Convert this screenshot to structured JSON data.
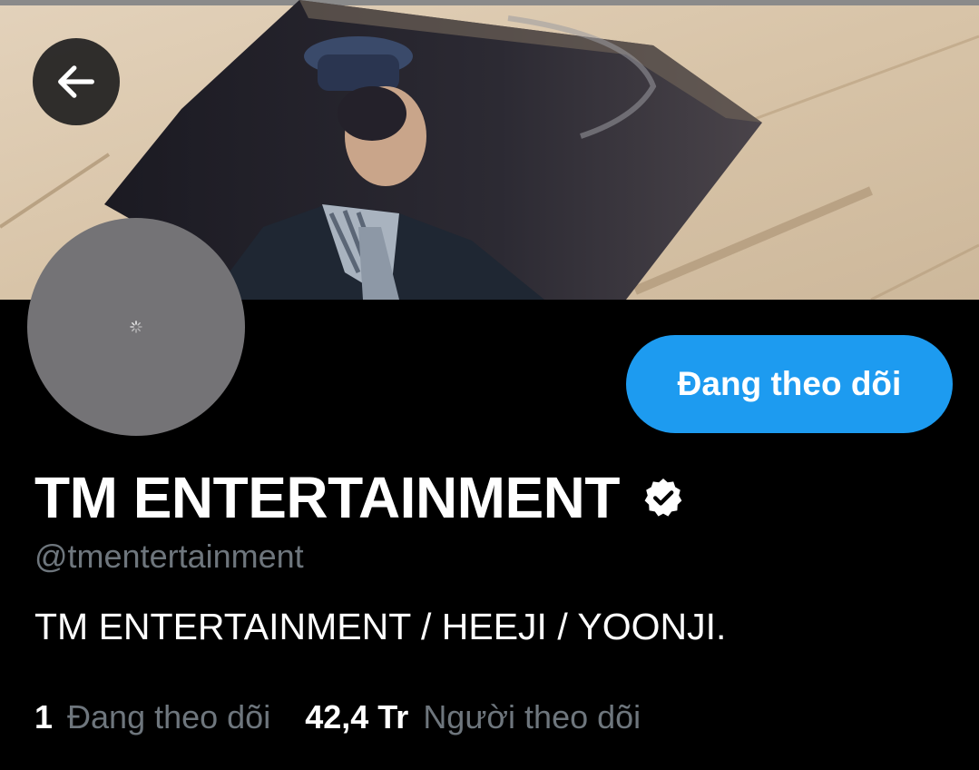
{
  "header": {
    "back_icon": "arrow-left-icon",
    "banner_photo": "profile-banner-photo"
  },
  "profile": {
    "avatar_state": "loading-spinner-icon",
    "follow_button_label": "Đang theo dõi",
    "display_name": "TM ENTERTAINMENT",
    "verified_icon": "verified-badge-icon",
    "handle": "@tmentertainment",
    "bio": "TM ENTERTAINMENT / HEEJI / YOONJI."
  },
  "stats": {
    "following_count": "1",
    "following_label": "Đang theo dõi",
    "followers_count": "42,4 Tr",
    "followers_label": "Người theo dõi"
  },
  "colors": {
    "background": "#000000",
    "accent": "#1d9bf0",
    "secondary_text": "#6e767d",
    "primary_text": "#ffffff",
    "avatar_placeholder": "#747376"
  }
}
